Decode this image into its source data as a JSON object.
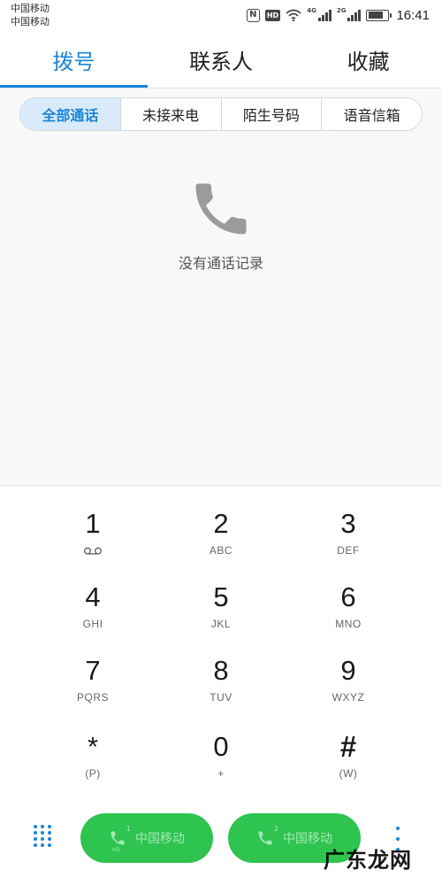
{
  "status_bar": {
    "carrier_1": "中国移动",
    "carrier_2": "中国移动",
    "nfc_label": "N",
    "hd_label": "HD",
    "net_4g": "4G",
    "net_2g": "2G",
    "time": "16:41",
    "battery_level": 0.75
  },
  "tabs": [
    {
      "label": "拨号",
      "active": true
    },
    {
      "label": "联系人",
      "active": false
    },
    {
      "label": "收藏",
      "active": false
    }
  ],
  "filters": [
    {
      "label": "全部通话",
      "active": true
    },
    {
      "label": "未接来电",
      "active": false
    },
    {
      "label": "陌生号码",
      "active": false
    },
    {
      "label": "语音信箱",
      "active": false
    }
  ],
  "empty_state": {
    "icon": "phone-icon",
    "text": "没有通话记录"
  },
  "dialpad": {
    "keys": [
      {
        "digit": "1",
        "sub": "",
        "sub_icon": "voicemail-icon"
      },
      {
        "digit": "2",
        "sub": "ABC"
      },
      {
        "digit": "3",
        "sub": "DEF"
      },
      {
        "digit": "4",
        "sub": "GHI"
      },
      {
        "digit": "5",
        "sub": "JKL"
      },
      {
        "digit": "6",
        "sub": "MNO"
      },
      {
        "digit": "7",
        "sub": "PQRS"
      },
      {
        "digit": "8",
        "sub": "TUV"
      },
      {
        "digit": "9",
        "sub": "WXYZ"
      },
      {
        "digit": "*",
        "sub": "(P)"
      },
      {
        "digit": "0",
        "sub": "+"
      },
      {
        "digit": "#",
        "sub": "(W)"
      }
    ]
  },
  "bottom_bar": {
    "call_1": {
      "label": "中国移动",
      "sim": "1",
      "hd": "HD"
    },
    "call_2": {
      "label": "中国移动",
      "sim": "2"
    }
  },
  "watermark": "广东龙网",
  "colors": {
    "accent": "#1a84d8",
    "call_green": "#2ec44f",
    "segment_active_bg": "#d9ebfa"
  }
}
